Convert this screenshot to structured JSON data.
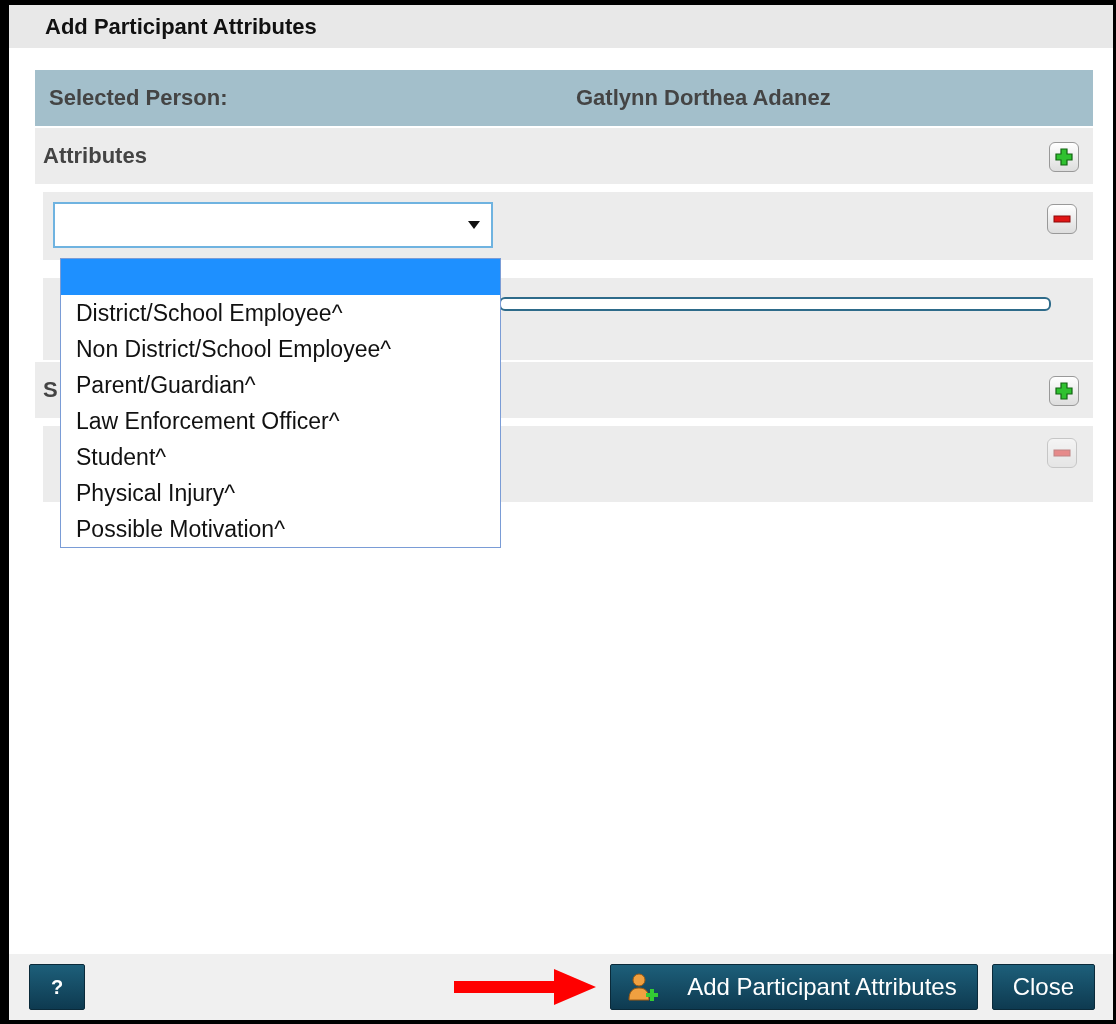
{
  "window": {
    "title": "Add Participant Attributes"
  },
  "selected_person": {
    "label": "Selected Person:",
    "name": "Gatlynn Dorthea Adanez"
  },
  "attributes": {
    "title": "Attributes",
    "rows": [
      {
        "kind": "select",
        "remove_disabled": false
      },
      {
        "kind": "text"
      }
    ]
  },
  "section_2": {
    "title": "S",
    "rows": [
      {
        "kind": "empty",
        "remove_disabled": true
      }
    ]
  },
  "dropdown": {
    "options": [
      {
        "selected": true
      },
      {
        "label": "District/School Employee^",
        "selected": false
      },
      {
        "label": "Non District/School Employee^",
        "selected": false
      },
      {
        "label": "Parent/Guardian^",
        "selected": false
      },
      {
        "label": "Law Enforcement Officer^",
        "selected": false
      },
      {
        "label": "Student^",
        "selected": false
      },
      {
        "label": "Physical Injury^",
        "selected": false
      },
      {
        "label": "Possible Motivation^",
        "selected": false
      }
    ]
  },
  "footer": {
    "help": "?",
    "primary": "Add Participant Attributes",
    "close": "Close",
    "pointer_arrow": true
  }
}
